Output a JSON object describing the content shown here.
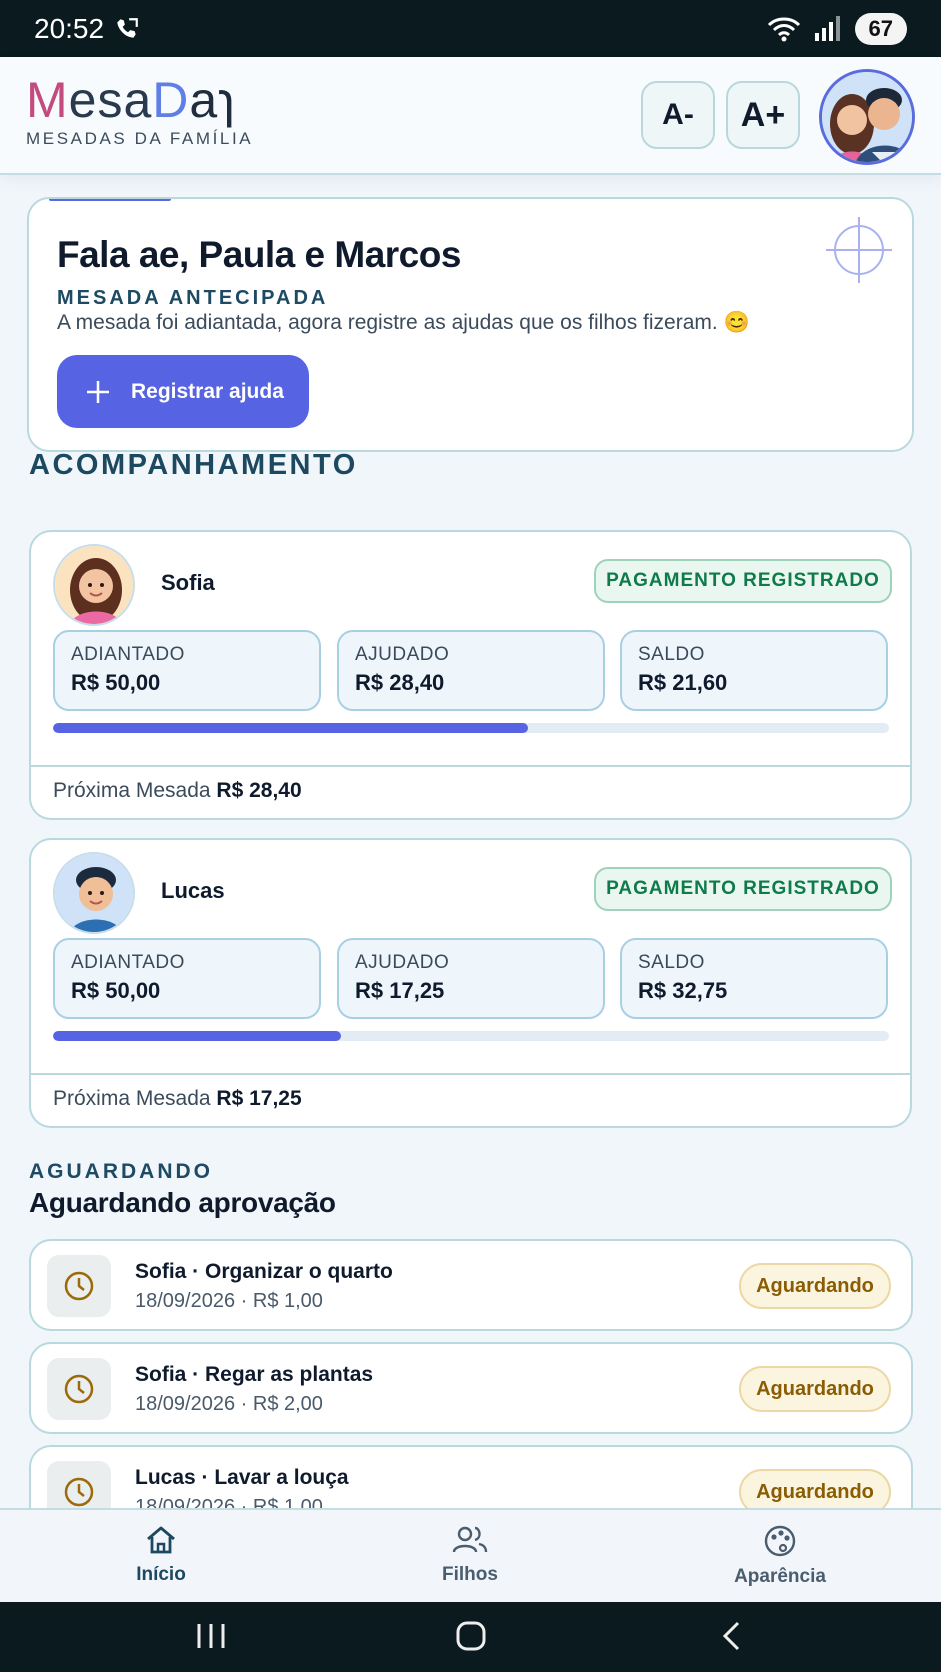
{
  "status_bar": {
    "time": "20:52",
    "battery": "67"
  },
  "header": {
    "logo_m": "M",
    "logo_esa": "esa",
    "logo_d": "D",
    "logo_tail": "aɿ",
    "logo_subtitle": "MESADAS DA FAMÍLIA",
    "font_decrease_label": "A-",
    "font_increase_label": "A+"
  },
  "greeting": {
    "title": "Fala ae, Paula e Marcos",
    "kicker": "MESADA ANTECIPADA",
    "message": "A mesada foi adiantada, agora registre as ajudas que os filhos fizeram. 😊",
    "button_label": "Registrar ajuda"
  },
  "tracking": {
    "section_title": "ACOMPANHAMENTO",
    "children": [
      {
        "name": "Sofia",
        "status": "PAGAMENTO REGISTRADO",
        "advanced_label": "ADIANTADO",
        "advanced_value": "R$ 50,00",
        "helped_label": "AJUDADO",
        "helped_value": "R$ 28,40",
        "balance_label": "SALDO",
        "balance_value": "R$ 21,60",
        "progress": 0.568,
        "next_label": "Próxima Mesada",
        "next_value": "R$ 28,40"
      },
      {
        "name": "Lucas",
        "status": "PAGAMENTO REGISTRADO",
        "advanced_label": "ADIANTADO",
        "advanced_value": "R$ 50,00",
        "helped_label": "AJUDADO",
        "helped_value": "R$ 17,25",
        "balance_label": "SALDO",
        "balance_value": "R$ 32,75",
        "progress": 0.345,
        "next_label": "Próxima Mesada",
        "next_value": "R$ 17,25"
      }
    ]
  },
  "pending": {
    "kicker": "AGUARDANDO",
    "title": "Aguardando aprovação",
    "items": [
      {
        "title": "Sofia · Organizar o quarto",
        "meta": "18/09/2026 · R$ 1,00",
        "badge": "Aguardando"
      },
      {
        "title": "Sofia · Regar as plantas",
        "meta": "18/09/2026 · R$ 2,00",
        "badge": "Aguardando"
      },
      {
        "title": "Lucas · Lavar a louça",
        "meta": "18/09/2026 · R$ 1,00",
        "badge": "Aguardando"
      }
    ]
  },
  "bottom_nav": {
    "items": [
      {
        "label": "Início",
        "icon": "home-icon"
      },
      {
        "label": "Filhos",
        "icon": "users-icon"
      },
      {
        "label": "Aparência",
        "icon": "palette-icon"
      }
    ]
  },
  "colors": {
    "primary": "#5663e3",
    "success": "#0f7a4a",
    "warning": "#8a5c04",
    "section": "#1c4960"
  }
}
